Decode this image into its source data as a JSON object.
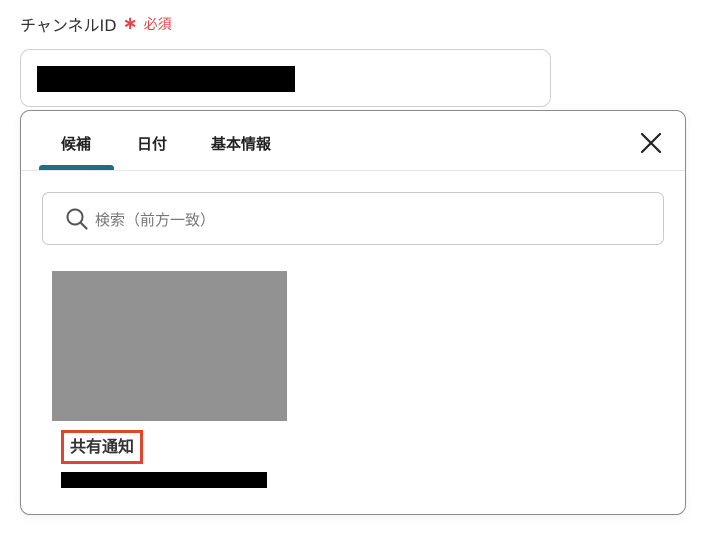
{
  "field": {
    "label": "チャンネルID",
    "required_mark": "∗",
    "required_text": "必須"
  },
  "popup": {
    "tabs": [
      {
        "label": "候補",
        "active": true
      },
      {
        "label": "日付",
        "active": false
      },
      {
        "label": "基本情報",
        "active": false
      }
    ],
    "close_icon": "close-icon",
    "search": {
      "placeholder": "検索（前方一致）",
      "value": "",
      "icon": "search-icon"
    },
    "results": [
      {
        "title": "共有通知"
      }
    ]
  },
  "colors": {
    "accent": "#1e6f86",
    "required": "#e0454a",
    "highlight_border": "#e0472a",
    "thumbnail_gray": "#929292"
  }
}
